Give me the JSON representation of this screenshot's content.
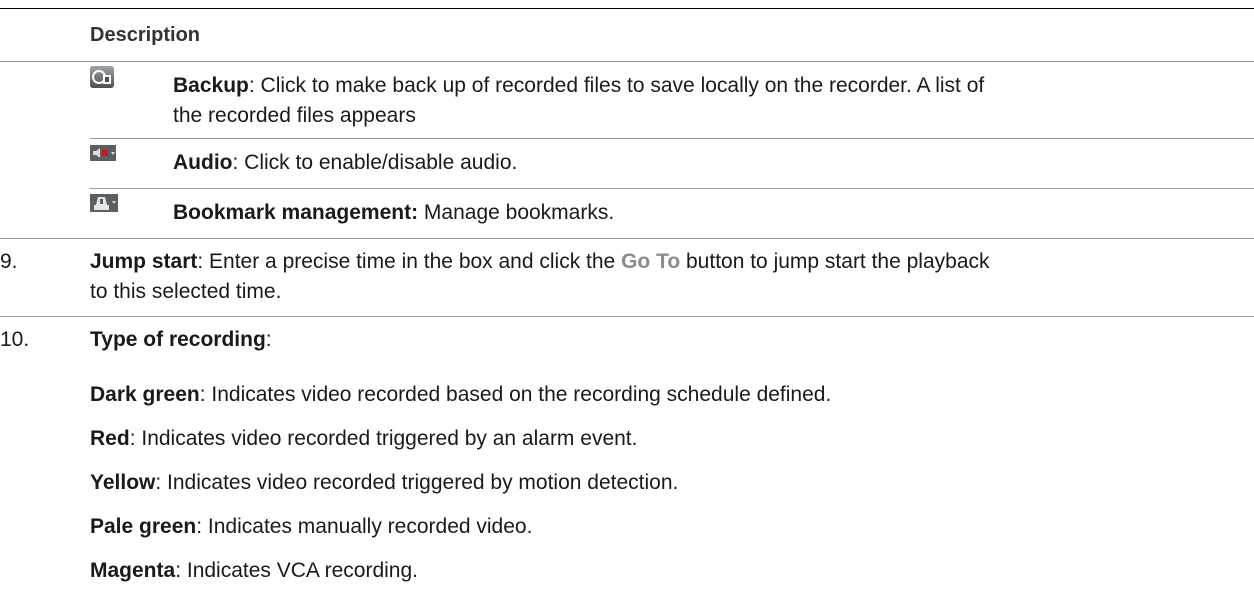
{
  "table": {
    "header": "Description",
    "rows": [
      {
        "icon": "backup-icon",
        "term": "Backup",
        "text": ": Click to make back up of recorded files to save locally on the recorder. A list of",
        "text_line2": "the recorded files appears"
      },
      {
        "icon": "audio-icon",
        "term": "Audio",
        "text": ": Click to enable/disable audio."
      },
      {
        "icon": "bookmark-icon",
        "term": "Bookmark management:",
        "text": " Manage bookmarks."
      }
    ]
  },
  "items": [
    {
      "number": "9.",
      "term": "Jump start",
      "text_before": ": Enter a precise time in the box and click the ",
      "button_label": "Go To",
      "text_after": " button to jump start the playback",
      "text_line2": "to this selected time."
    },
    {
      "number": "10.",
      "term": "Type of recording",
      "term_suffix": ":",
      "entries": [
        {
          "term": "Dark green",
          "text": ": Indicates video recorded based on the recording schedule defined."
        },
        {
          "term": "Red",
          "text": ": Indicates video recorded triggered by an alarm event."
        },
        {
          "term": "Yellow",
          "text": ": Indicates video recorded triggered by motion detection."
        },
        {
          "term": "Pale green",
          "text": ": Indicates manually recorded video."
        },
        {
          "term": "Magenta",
          "text": ": Indicates VCA recording."
        }
      ]
    }
  ],
  "colors": {
    "rule": "#9a9a9a",
    "heading": "#333333",
    "goto": "#8c8c8c",
    "audio_red": "#d0141a"
  }
}
